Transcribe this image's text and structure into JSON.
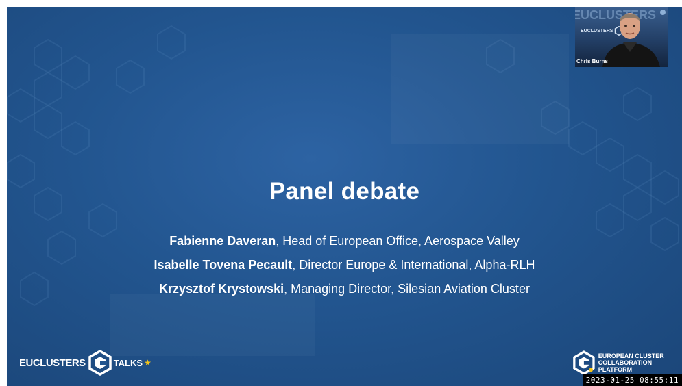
{
  "slide": {
    "title": "Panel debate",
    "panelists": [
      {
        "name": "Fabienne Daveran",
        "role": ", Head of European Office, Aerospace Valley"
      },
      {
        "name": "Isabelle Tovena Pecault",
        "role": ", Director Europe & International, Alpha-RLH"
      },
      {
        "name": "Krzysztof Krystowski",
        "role": ", Managing Director, Silesian Aviation Cluster"
      }
    ],
    "background_color": "#22558f"
  },
  "logos": {
    "left_brand": "EUCLUSTERS",
    "left_sub": "TALKS",
    "right_line1": "EUROPEAN CLUSTER",
    "right_line2": "COLLABORATION PLATFORM",
    "accent_color": "#f5c518"
  },
  "webcam": {
    "participant_name": "Chris Burns",
    "background_text": "EUCLUSTERS",
    "mini_logo_text": "EUCLUSTERS"
  },
  "overlay": {
    "timestamp": "2023-01-25 08:55:11"
  }
}
